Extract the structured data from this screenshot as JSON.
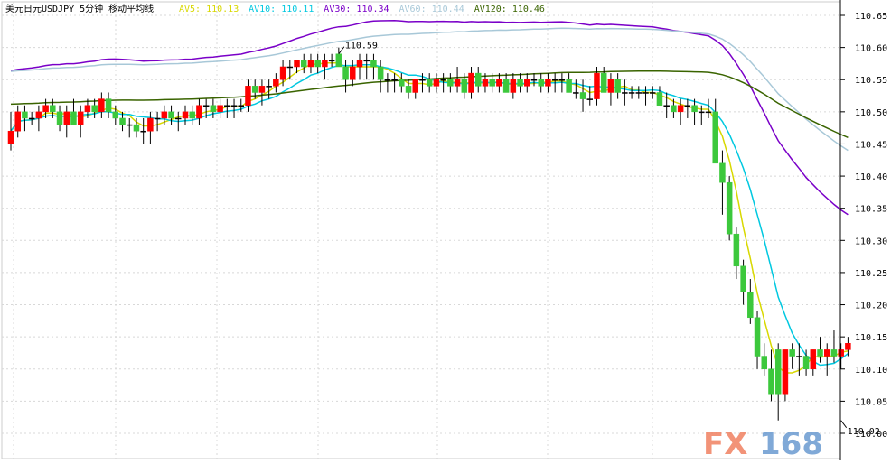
{
  "chart_data": {
    "type": "candlestick",
    "title": "美元日元USDJPY 5分钟 移动平均线",
    "moving_averages": [
      {
        "name": "AV5",
        "value": "110.13",
        "color": "#d8d800"
      },
      {
        "name": "AV10",
        "value": "110.11",
        "color": "#00c8e0"
      },
      {
        "name": "AV30",
        "value": "110.34",
        "color": "#7a00c8"
      },
      {
        "name": "AV60",
        "value": "110.44",
        "color": "#a8c8d8"
      },
      {
        "name": "AV120",
        "value": "110.46",
        "color": "#3a6400"
      }
    ],
    "ylim": [
      110.0,
      110.65
    ],
    "yticks": [
      "110.65",
      "110.60",
      "110.55",
      "110.50",
      "110.45",
      "110.40",
      "110.35",
      "110.30",
      "110.25",
      "110.20",
      "110.15",
      "110.10",
      "110.05",
      "110.00"
    ],
    "annotations": [
      {
        "text": "110.59",
        "x": 47,
        "y": 110.59
      },
      {
        "text": "110.02",
        "x": 119,
        "y": 110.02
      }
    ],
    "up_color": "#ff0000",
    "down_color": "#3cc83c",
    "candles": [
      [
        110.45,
        110.5,
        110.44,
        110.47
      ],
      [
        110.47,
        110.51,
        110.46,
        110.5
      ],
      [
        110.5,
        110.51,
        110.47,
        110.49
      ],
      [
        110.49,
        110.5,
        110.48,
        110.49
      ],
      [
        110.49,
        110.51,
        110.47,
        110.5
      ],
      [
        110.5,
        110.52,
        110.49,
        110.51
      ],
      [
        110.51,
        110.52,
        110.49,
        110.5
      ],
      [
        110.5,
        110.51,
        110.47,
        110.48
      ],
      [
        110.48,
        110.51,
        110.46,
        110.5
      ],
      [
        110.5,
        110.52,
        110.48,
        110.48
      ],
      [
        110.48,
        110.51,
        110.46,
        110.5
      ],
      [
        110.5,
        110.52,
        110.49,
        110.51
      ],
      [
        110.51,
        110.52,
        110.49,
        110.5
      ],
      [
        110.5,
        110.53,
        110.49,
        110.52
      ],
      [
        110.52,
        110.53,
        110.49,
        110.5
      ],
      [
        110.5,
        110.51,
        110.48,
        110.49
      ],
      [
        110.49,
        110.5,
        110.47,
        110.48
      ],
      [
        110.48,
        110.49,
        110.46,
        110.48
      ],
      [
        110.48,
        110.49,
        110.46,
        110.47
      ],
      [
        110.47,
        110.49,
        110.45,
        110.47
      ],
      [
        110.47,
        110.5,
        110.45,
        110.49
      ],
      [
        110.49,
        110.5,
        110.47,
        110.49
      ],
      [
        110.49,
        110.51,
        110.48,
        110.5
      ],
      [
        110.5,
        110.51,
        110.48,
        110.49
      ],
      [
        110.49,
        110.5,
        110.47,
        110.49
      ],
      [
        110.49,
        110.51,
        110.48,
        110.5
      ],
      [
        110.5,
        110.51,
        110.48,
        110.49
      ],
      [
        110.49,
        110.52,
        110.48,
        110.51
      ],
      [
        110.51,
        110.52,
        110.49,
        110.51
      ],
      [
        110.51,
        110.52,
        110.49,
        110.5
      ],
      [
        110.5,
        110.52,
        110.49,
        110.51
      ],
      [
        110.51,
        110.52,
        110.49,
        110.51
      ],
      [
        110.51,
        110.52,
        110.49,
        110.51
      ],
      [
        110.51,
        110.52,
        110.5,
        110.51
      ],
      [
        110.51,
        110.55,
        110.5,
        110.54
      ],
      [
        110.54,
        110.55,
        110.52,
        110.53
      ],
      [
        110.53,
        110.55,
        110.51,
        110.54
      ],
      [
        110.54,
        110.55,
        110.52,
        110.54
      ],
      [
        110.54,
        110.56,
        110.53,
        110.55
      ],
      [
        110.55,
        110.58,
        110.54,
        110.57
      ],
      [
        110.57,
        110.58,
        110.55,
        110.57
      ],
      [
        110.57,
        110.58,
        110.56,
        110.58
      ],
      [
        110.58,
        110.59,
        110.56,
        110.57
      ],
      [
        110.57,
        110.59,
        110.56,
        110.58
      ],
      [
        110.58,
        110.59,
        110.56,
        110.57
      ],
      [
        110.57,
        110.59,
        110.55,
        110.58
      ],
      [
        110.58,
        110.59,
        110.57,
        110.58
      ],
      [
        110.59,
        110.6,
        110.57,
        110.57
      ],
      [
        110.57,
        110.58,
        110.53,
        110.55
      ],
      [
        110.55,
        110.58,
        110.54,
        110.57
      ],
      [
        110.57,
        110.59,
        110.55,
        110.58
      ],
      [
        110.58,
        110.59,
        110.55,
        110.58
      ],
      [
        110.58,
        110.59,
        110.55,
        110.57
      ],
      [
        110.57,
        110.58,
        110.53,
        110.55
      ],
      [
        110.55,
        110.56,
        110.53,
        110.55
      ],
      [
        110.55,
        110.56,
        110.53,
        110.55
      ],
      [
        110.55,
        110.56,
        110.53,
        110.54
      ],
      [
        110.54,
        110.55,
        110.52,
        110.53
      ],
      [
        110.53,
        110.55,
        110.52,
        110.55
      ],
      [
        110.55,
        110.56,
        110.53,
        110.55
      ],
      [
        110.55,
        110.56,
        110.53,
        110.54
      ],
      [
        110.54,
        110.56,
        110.53,
        110.55
      ],
      [
        110.55,
        110.56,
        110.53,
        110.55
      ],
      [
        110.55,
        110.56,
        110.53,
        110.54
      ],
      [
        110.54,
        110.57,
        110.53,
        110.55
      ],
      [
        110.55,
        110.56,
        110.52,
        110.53
      ],
      [
        110.53,
        110.57,
        110.52,
        110.56
      ],
      [
        110.56,
        110.57,
        110.53,
        110.54
      ],
      [
        110.54,
        110.56,
        110.53,
        110.55
      ],
      [
        110.55,
        110.56,
        110.53,
        110.54
      ],
      [
        110.54,
        110.56,
        110.53,
        110.55
      ],
      [
        110.55,
        110.56,
        110.53,
        110.53
      ],
      [
        110.53,
        110.56,
        110.52,
        110.55
      ],
      [
        110.55,
        110.56,
        110.53,
        110.54
      ],
      [
        110.54,
        110.56,
        110.53,
        110.55
      ],
      [
        110.55,
        110.56,
        110.54,
        110.55
      ],
      [
        110.55,
        110.56,
        110.53,
        110.54
      ],
      [
        110.54,
        110.56,
        110.53,
        110.55
      ],
      [
        110.55,
        110.56,
        110.53,
        110.55
      ],
      [
        110.55,
        110.56,
        110.53,
        110.55
      ],
      [
        110.55,
        110.56,
        110.53,
        110.53
      ],
      [
        110.53,
        110.55,
        110.52,
        110.53
      ],
      [
        110.53,
        110.55,
        110.5,
        110.52
      ],
      [
        110.52,
        110.54,
        110.51,
        110.52
      ],
      [
        110.52,
        110.57,
        110.51,
        110.56
      ],
      [
        110.56,
        110.57,
        110.53,
        110.53
      ],
      [
        110.53,
        110.56,
        110.51,
        110.55
      ],
      [
        110.55,
        110.56,
        110.52,
        110.53
      ],
      [
        110.53,
        110.55,
        110.51,
        110.53
      ],
      [
        110.53,
        110.54,
        110.52,
        110.53
      ],
      [
        110.53,
        110.54,
        110.52,
        110.53
      ],
      [
        110.53,
        110.54,
        110.51,
        110.53
      ],
      [
        110.53,
        110.54,
        110.52,
        110.53
      ],
      [
        110.53,
        110.54,
        110.51,
        110.51
      ],
      [
        110.51,
        110.53,
        110.49,
        110.51
      ],
      [
        110.51,
        110.52,
        110.49,
        110.5
      ],
      [
        110.5,
        110.52,
        110.48,
        110.51
      ],
      [
        110.51,
        110.52,
        110.49,
        110.51
      ],
      [
        110.51,
        110.52,
        110.48,
        110.5
      ],
      [
        110.5,
        110.51,
        110.48,
        110.5
      ],
      [
        110.5,
        110.52,
        110.49,
        110.5
      ],
      [
        110.5,
        110.52,
        110.48,
        110.42
      ],
      [
        110.42,
        110.44,
        110.34,
        110.39
      ],
      [
        110.39,
        110.4,
        110.3,
        110.31
      ],
      [
        110.31,
        110.32,
        110.24,
        110.26
      ],
      [
        110.26,
        110.27,
        110.2,
        110.22
      ],
      [
        110.22,
        110.24,
        110.17,
        110.18
      ],
      [
        110.18,
        110.19,
        110.1,
        110.12
      ],
      [
        110.12,
        110.14,
        110.09,
        110.1
      ],
      [
        110.1,
        110.13,
        110.05,
        110.06
      ],
      [
        110.13,
        110.14,
        110.02,
        110.06
      ],
      [
        110.06,
        110.13,
        110.05,
        110.13
      ],
      [
        110.13,
        110.14,
        110.1,
        110.12
      ],
      [
        110.12,
        110.14,
        110.09,
        110.12
      ],
      [
        110.12,
        110.13,
        110.09,
        110.1
      ],
      [
        110.1,
        110.13,
        110.09,
        110.13
      ],
      [
        110.13,
        110.15,
        110.11,
        110.12
      ],
      [
        110.12,
        110.14,
        110.09,
        110.13
      ],
      [
        110.13,
        110.16,
        110.11,
        110.12
      ],
      [
        110.12,
        110.14,
        110.1,
        110.13
      ],
      [
        110.13,
        110.15,
        110.12,
        110.14
      ]
    ]
  },
  "watermark": {
    "text_left": "FX",
    "text_right": "168",
    "color_left": "#f08060",
    "color_right": "#6a9ad0"
  }
}
